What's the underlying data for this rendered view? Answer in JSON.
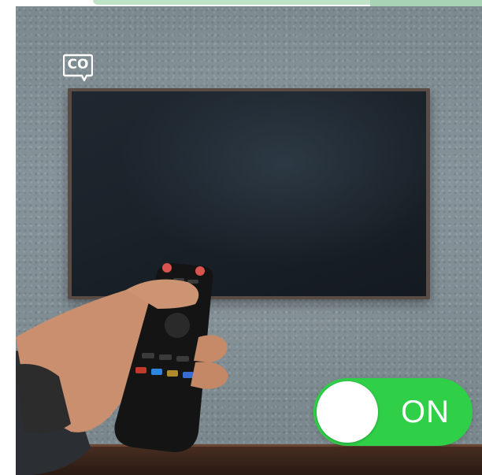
{
  "caption_badge": {
    "label": "CO",
    "icon": "closed-captions-icon"
  },
  "power_toggle": {
    "label": "ON",
    "state": "on",
    "accent_color": "#2fcf48",
    "knob_color": "#ffffff"
  },
  "scene": {
    "subject": "hand-holding-tv-remote",
    "display": "wall-mounted-tv",
    "tv_screen_state": "off"
  }
}
